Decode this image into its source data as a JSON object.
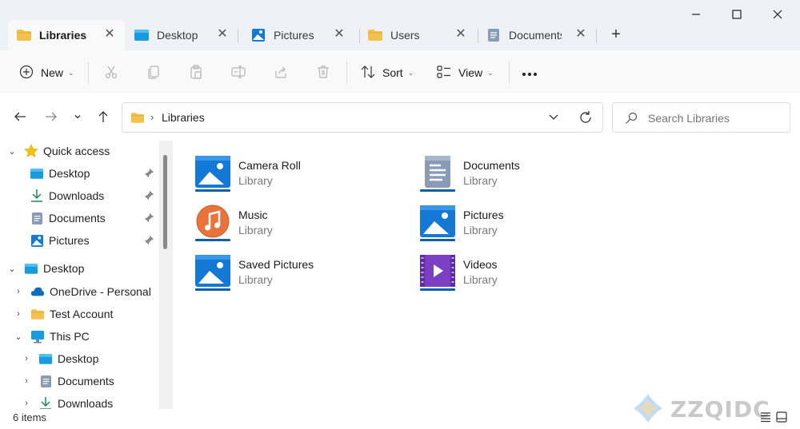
{
  "tabs": [
    {
      "label": "Libraries",
      "icon": "folder-icon",
      "active": true
    },
    {
      "label": "Desktop",
      "icon": "desktop-icon",
      "active": false
    },
    {
      "label": "Pictures",
      "icon": "pictures-icon",
      "active": false
    },
    {
      "label": "Users",
      "icon": "folder-icon",
      "active": false
    },
    {
      "label": "Documents",
      "icon": "documents-icon",
      "active": false
    }
  ],
  "toolbar": {
    "new_label": "New",
    "sort_label": "Sort",
    "view_label": "View"
  },
  "address": {
    "path": "Libraries"
  },
  "search": {
    "placeholder": "Search Libraries"
  },
  "nav": {
    "quick_access": "Quick access",
    "quick_items": [
      {
        "label": "Desktop",
        "icon": "desktop-icon"
      },
      {
        "label": "Downloads",
        "icon": "downloads-icon"
      },
      {
        "label": "Documents",
        "icon": "documents-icon"
      },
      {
        "label": "Pictures",
        "icon": "pictures-icon"
      }
    ],
    "desktop": "Desktop",
    "onedrive": "OneDrive - Personal",
    "test_account": "Test Account",
    "this_pc": "This PC",
    "pc_items": [
      {
        "label": "Desktop"
      },
      {
        "label": "Documents"
      },
      {
        "label": "Downloads"
      }
    ]
  },
  "libraries": [
    {
      "name": "Camera Roll",
      "type": "Library",
      "icon": "pictures-library-icon"
    },
    {
      "name": "Documents",
      "type": "Library",
      "icon": "documents-library-icon"
    },
    {
      "name": "Music",
      "type": "Library",
      "icon": "music-library-icon"
    },
    {
      "name": "Pictures",
      "type": "Library",
      "icon": "pictures-library-icon"
    },
    {
      "name": "Saved Pictures",
      "type": "Library",
      "icon": "pictures-library-icon"
    },
    {
      "name": "Videos",
      "type": "Library",
      "icon": "videos-library-icon"
    }
  ],
  "status": {
    "item_count": "6 items"
  },
  "watermark": {
    "text": "ZZQIDC"
  },
  "colors": {
    "accent": "#0067c0",
    "folder": "#f2c14e",
    "music": "#e8743b",
    "videos": "#7b3fc4"
  }
}
